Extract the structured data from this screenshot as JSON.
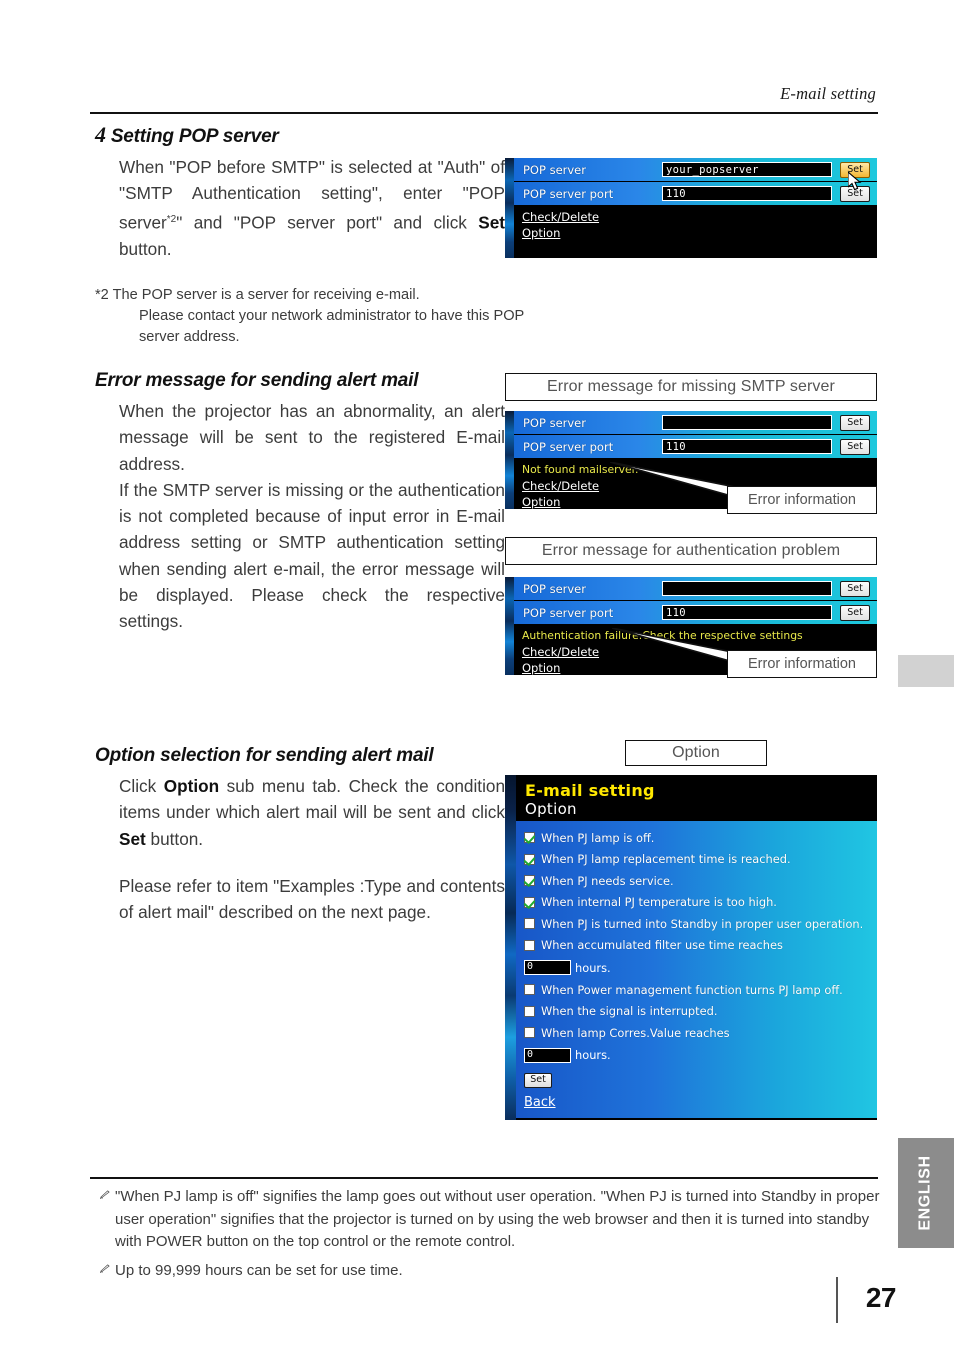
{
  "header": {
    "title": "E-mail setting"
  },
  "page": {
    "number": "27",
    "side_tab": "ENGLISH"
  },
  "section_pop": {
    "number": "4",
    "heading": "Setting POP server",
    "body_1": "When \"POP before SMTP\" is selected at \"Auth\" of \"SMTP Authentication setting\", enter \"POP server",
    "body_sup": "*2",
    "body_2": "\" and \"POP server port\" and click ",
    "body_bold": "Set",
    "body_3": " button.",
    "footnote_marker": "*2",
    "footnote_line1": "The POP server is a server for receiving e-mail.",
    "footnote_line2": "Please contact your network administrator to have this POP server address."
  },
  "section_error": {
    "heading": "Error message for sending alert mail",
    "body": "When the projector has an abnormality, an alert message will be sent to the registered E-mail address. If the SMTP server is missing or the authentication is not completed because of input error in E-mail address setting or SMTP authentication setting when sending alert e-mail, the error message will be displayed. Please check the respective settings.",
    "body_para1": "When the projector has an abnormality, an alert message will be sent to the registered E-mail address.",
    "body_para2": "If the SMTP server is missing or the authentication is not completed because of input error in E-mail address setting or SMTP authentication setting when sending alert e-mail, the error message will be displayed. Please check the respective settings."
  },
  "section_option": {
    "heading": "Option selection for sending alert mail",
    "body_p1_a": "Click ",
    "body_p1_bold1": "Option",
    "body_p1_b": " sub menu tab. Check the condition items under which alert mail will be sent and click ",
    "body_p1_bold2": "Set",
    "body_p1_c": " button.",
    "body_p2": "Please refer to item \"Examples :Type and contents of alert mail\" described on the next page."
  },
  "captions": {
    "missing_smtp": "Error message for missing SMTP server",
    "auth_problem": "Error message for authentication problem",
    "option": "Option",
    "error_information": "Error information"
  },
  "panel_pop": {
    "rows": [
      {
        "label": "POP server",
        "value": "your_popserver",
        "button": "Set",
        "button_hot": true
      },
      {
        "label": "POP server port",
        "value": "110",
        "button": "Set",
        "button_hot": false
      }
    ],
    "links": [
      "Check/Delete",
      "Option"
    ]
  },
  "panel_error_missing": {
    "rows": [
      {
        "label": "POP server",
        "value": "",
        "button": "Set"
      },
      {
        "label": "POP server port",
        "value": "110",
        "button": "Set"
      }
    ],
    "error_text": "Not found mailserver.",
    "links": [
      "Check/Delete",
      "Option"
    ]
  },
  "panel_error_auth": {
    "rows": [
      {
        "label": "POP server",
        "value": "",
        "button": "Set"
      },
      {
        "label": "POP server port",
        "value": "110",
        "button": "Set"
      }
    ],
    "error_text": "Authentication failure.Check the respective settings",
    "links": [
      "Check/Delete",
      "Option"
    ]
  },
  "panel_option": {
    "title_line1": "E-mail setting",
    "title_line2": "Option",
    "checkboxes": [
      {
        "label": "When PJ lamp is off.",
        "checked": true
      },
      {
        "label": "When PJ lamp replacement time is reached.",
        "checked": true
      },
      {
        "label": "When PJ needs service.",
        "checked": true
      },
      {
        "label": "When internal PJ temperature is too high.",
        "checked": true
      },
      {
        "label": "When PJ is turned into Standby in proper user operation.",
        "checked": false
      },
      {
        "label": "When accumulated filter use time reaches",
        "checked": false
      }
    ],
    "hours_field_1": "0",
    "hours_label_1": "hours.",
    "checkboxes_2": [
      {
        "label": "When Power management function turns PJ lamp off.",
        "checked": false
      },
      {
        "label": "When the signal is interrupted.",
        "checked": false
      },
      {
        "label": "When lamp Corres.Value reaches",
        "checked": false
      }
    ],
    "hours_field_2": "0",
    "hours_label_2": "hours.",
    "set_button": "Set",
    "back_link": "Back"
  },
  "footnotes": [
    "\"When PJ lamp is off\" signifies the lamp goes out without user operation. \"When PJ is turned into Standby  in proper user operation\" signifies that the projector is turned on by using the web browser and then it is turned into standby with POWER button on the top control or the remote control.",
    "Up to 99,999 hours can be set for use time."
  ],
  "colors": {
    "accent_yellow": "#ffe800",
    "error_yellow": "#e9e94a",
    "panel_blue": "#1f73da",
    "tab_gray": "#8c8c8c",
    "side_tab_light": "#d2d2d2"
  }
}
